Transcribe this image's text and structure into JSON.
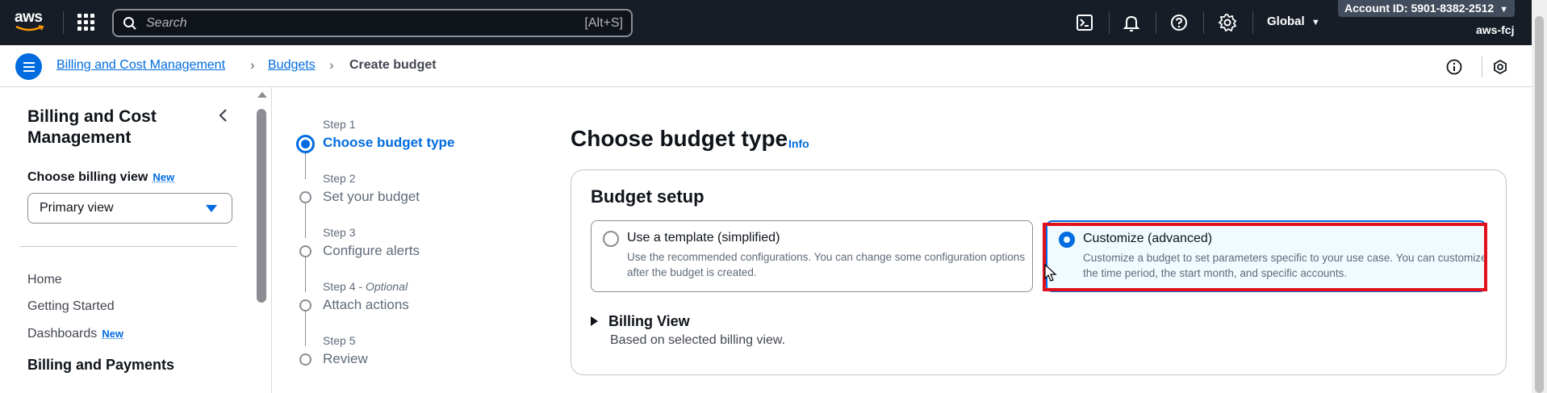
{
  "topbar": {
    "logo_text": "aws",
    "search_placeholder": "Search",
    "search_shortcut": "[Alt+S]",
    "region": "Global",
    "account_id": "Account ID: 5901-8382-2512",
    "account_alias": "aws-fcj",
    "icons": [
      "cloudshell-icon",
      "notifications-icon",
      "help-icon",
      "settings-icon"
    ]
  },
  "breadcrumb": {
    "items": [
      {
        "label": "Billing and Cost Management",
        "link": true
      },
      {
        "label": "Budgets",
        "link": true
      },
      {
        "label": "Create budget",
        "link": false
      }
    ]
  },
  "sidebar": {
    "title": "Billing and Cost Management",
    "billing_view_label": "Choose billing view",
    "new_badge": "New",
    "billing_view_value": "Primary view",
    "links": [
      "Home",
      "Getting Started",
      "Dashboards"
    ],
    "dashboards_badge": "New",
    "section": "Billing and Payments"
  },
  "steps": [
    {
      "num": "Step 1",
      "title": "Choose budget type",
      "active": true
    },
    {
      "num": "Step 2",
      "title": "Set your budget"
    },
    {
      "num": "Step 3",
      "title": "Configure alerts"
    },
    {
      "num": "Step 4",
      "optional": "Optional",
      "title": "Attach actions"
    },
    {
      "num": "Step 5",
      "title": "Review"
    }
  ],
  "main": {
    "title": "Choose budget type",
    "info": "Info",
    "panel_title": "Budget setup",
    "options": [
      {
        "title": "Use a template (simplified)",
        "desc": "Use the recommended configurations. You can change some configuration options after the budget is created.",
        "selected": false
      },
      {
        "title": "Customize (advanced)",
        "desc": "Customize a budget to set parameters specific to your use case. You can customize the time period, the start month, and specific accounts.",
        "selected": true
      }
    ],
    "billing_view_title": "Billing View",
    "billing_view_desc": "Based on selected billing view."
  },
  "colors": {
    "accent": "#006ce0",
    "topbar": "#161d26",
    "highlight": "#e0111b"
  }
}
